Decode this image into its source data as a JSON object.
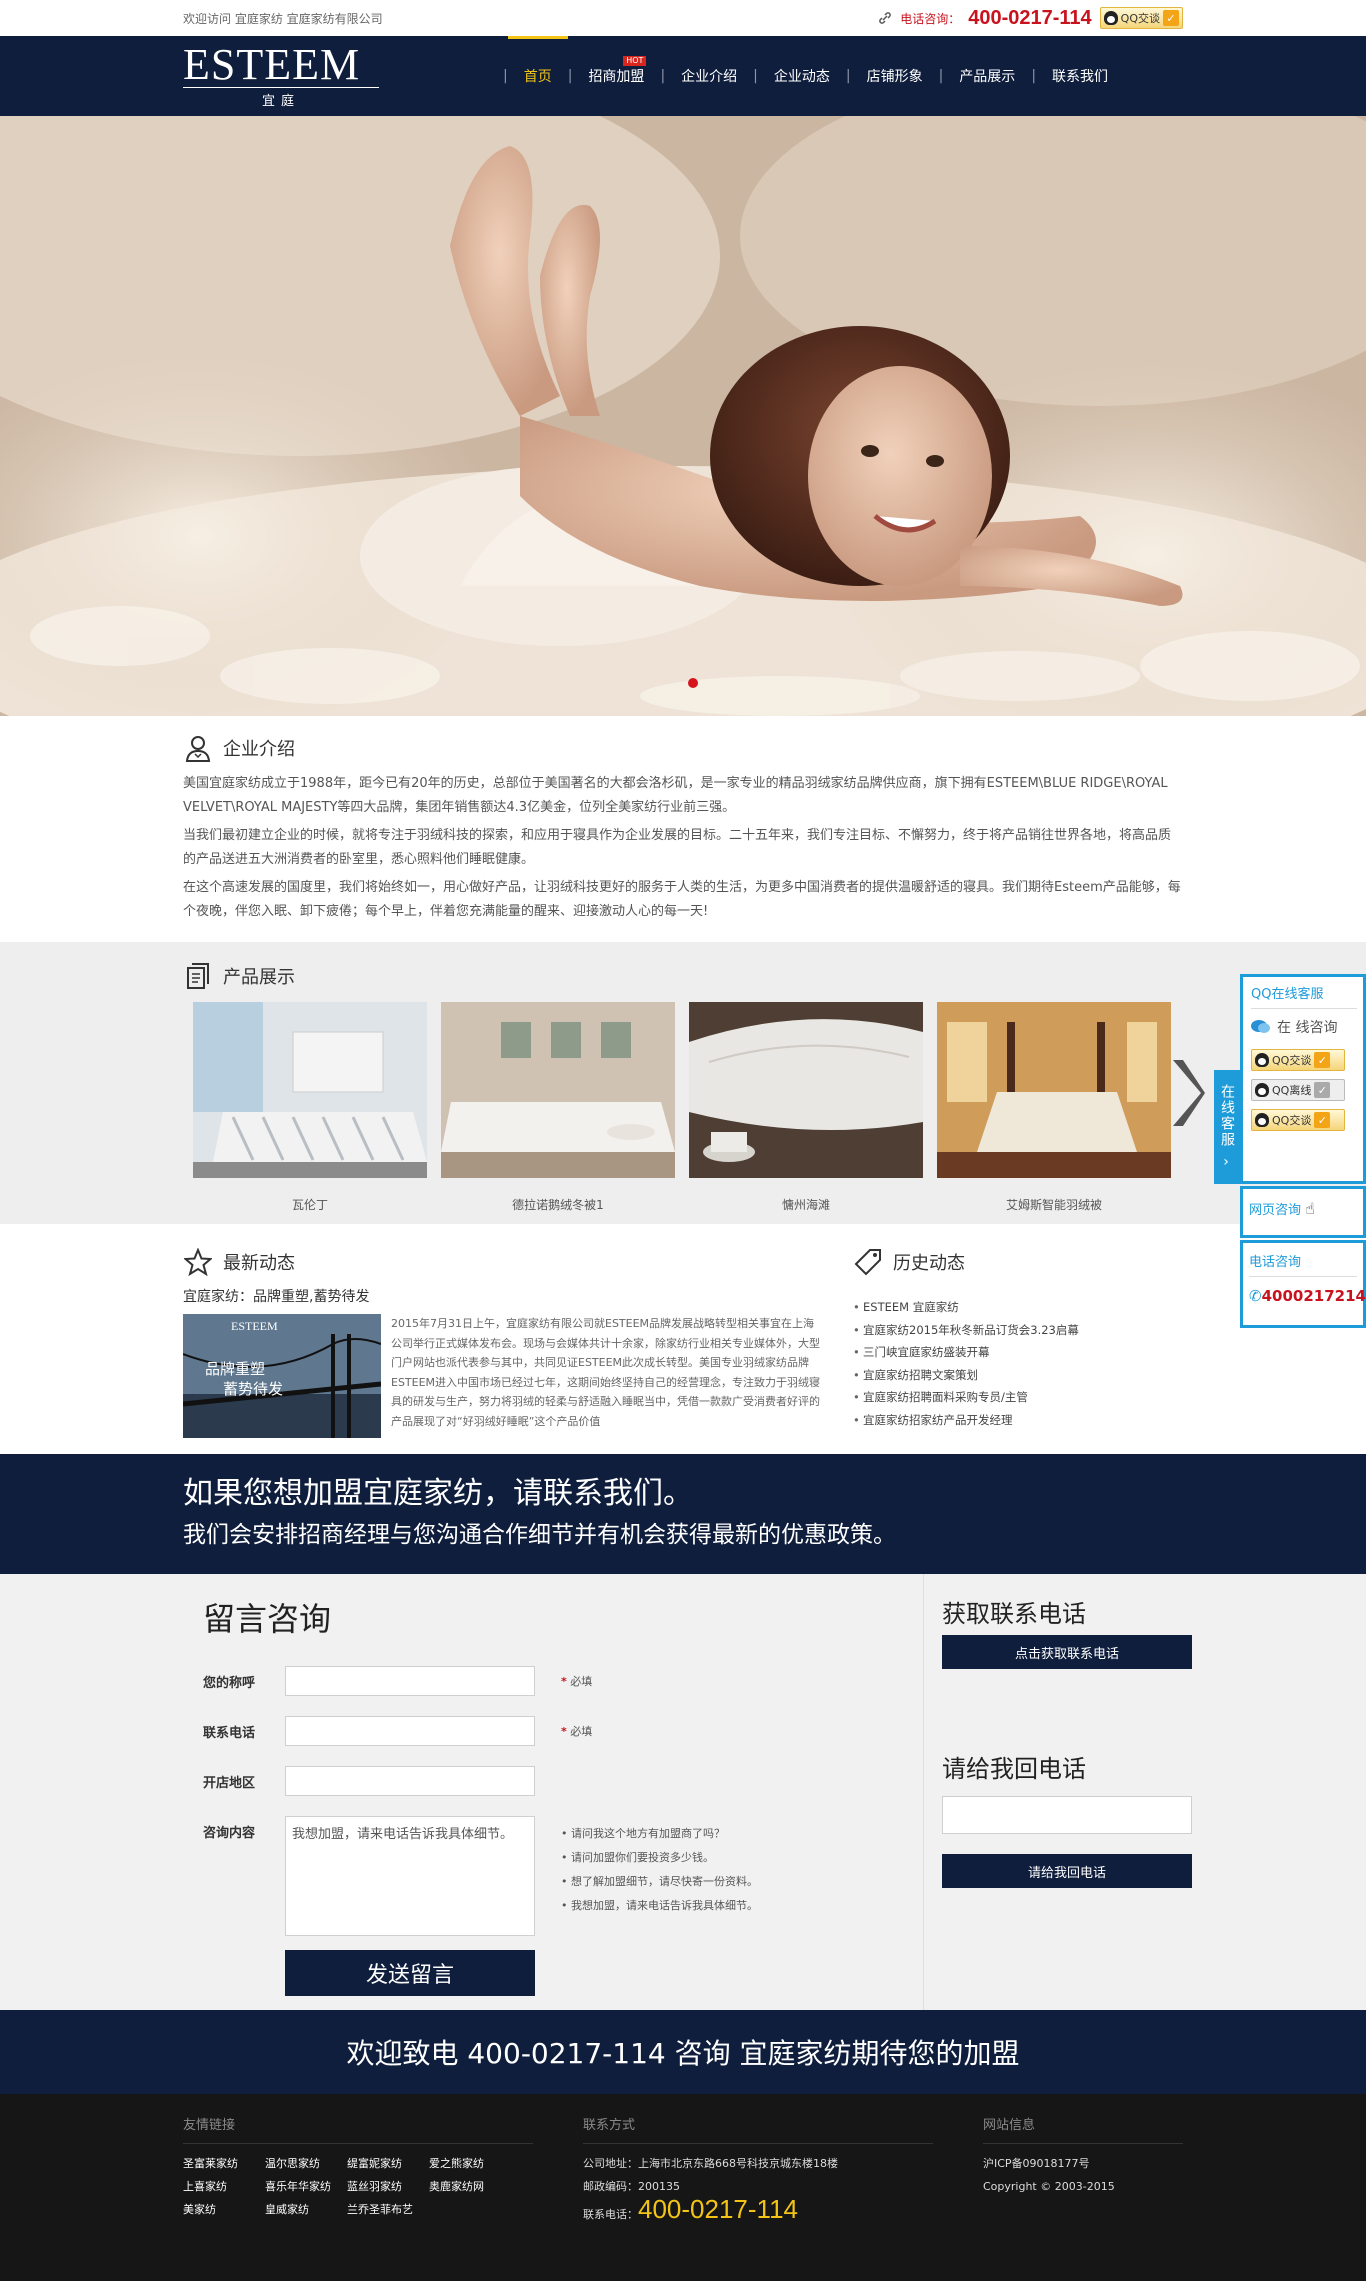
{
  "topbar": {
    "welcome": "欢迎访问 宜庭家纺 宜庭家纺有限公司",
    "phone_label": "电话咨询：",
    "phone": "400-0217-114",
    "qq_label": "QQ交谈"
  },
  "nav": {
    "logo_brand": "ESTEEM",
    "logo_sub": "宜庭",
    "items": [
      {
        "label": "首页"
      },
      {
        "label": "招商加盟",
        "badge": "HOT"
      },
      {
        "label": "企业介绍"
      },
      {
        "label": "企业动态"
      },
      {
        "label": "店铺形象"
      },
      {
        "label": "产品展示"
      },
      {
        "label": "联系我们"
      }
    ]
  },
  "intro": {
    "title": "企业介绍",
    "p1": "美国宜庭家纺成立于1988年，距今已有20年的历史，总部位于美国著名的大都会洛杉矶，是一家专业的精品羽绒家纺品牌供应商，旗下拥有ESTEEM\\BLUE RIDGE\\ROYAL VELVET\\ROYAL MAJESTY等四大品牌，集团年销售额达4.3亿美金，位列全美家纺行业前三强。",
    "p2": "当我们最初建立企业的时候，就将专注于羽绒科技的探索，和应用于寝具作为企业发展的目标。二十五年来，我们专注目标、不懈努力，终于将产品销往世界各地，将高品质的产品送进五大洲消费者的卧室里，悉心照料他们睡眠健康。",
    "p3": "在这个高速发展的国度里，我们将始终如一，用心做好产品，让羽绒科技更好的服务于人类的生活，为更多中国消费者的提供温暖舒适的寝具。我们期待Esteem产品能够，每个夜晚，伴您入眠、卸下疲倦；每个早上，伴着您充满能量的醒来、迎接激动人心的每一天!"
  },
  "products": {
    "title": "产品展示",
    "items": [
      {
        "name": "瓦伦丁"
      },
      {
        "name": "德拉诺鹅绒冬被1"
      },
      {
        "name": "慵州海滩"
      },
      {
        "name": "艾姆斯智能羽绒被"
      }
    ]
  },
  "news": {
    "title": "最新动态",
    "headline": "宜庭家纺：品牌重塑,蓄势待发",
    "thumb_logo": "ESTEEM",
    "thumb_text1": "品牌重塑",
    "thumb_text2": "蓄势待发",
    "body": "2015年7月31日上午，宜庭家纺有限公司就ESTEEM品牌发展战略转型相关事宜在上海公司举行正式媒体发布会。现场与会媒体共计十余家，除家纺行业相关专业媒体外，大型门户网站也派代表参与其中，共同见证ESTEEM此次成长转型。美国专业羽绒家纺品牌ESTEEM进入中国市场已经过七年，这期间始终坚持自己的经营理念，专注致力于羽绒寝具的研发与生产，努力将羽绒的轻柔与舒适融入睡眠当中，凭借一款款广受消费者好评的产品展现了对“好羽绒好睡眠”这个产品价值"
  },
  "history": {
    "title": "历史动态",
    "items": [
      "ESTEEM 宜庭家纺",
      "宜庭家纺2015年秋冬新品订货会3.23启幕",
      "三门峡宜庭家纺盛装开幕",
      "宜庭家纺招聘文案策划",
      "宜庭家纺招聘面料采购专员/主管",
      "宜庭家纺招家纺产品开发经理"
    ]
  },
  "banner": {
    "line1": "如果您想加盟宜庭家纺，请联系我们。",
    "line2": "我们会安排招商经理与您沟通合作细节并有机会获得最新的优惠政策。"
  },
  "form": {
    "title": "留言咨询",
    "name_label": "您的称呼",
    "phone_label": "联系电话",
    "region_label": "开店地区",
    "content_label": "咨询内容",
    "required": "必填",
    "message_value": "我想加盟，请来电话告诉我具体细节。",
    "hints": [
      "请问我这个地方有加盟商了吗？",
      "请问加盟你们要投资多少钱。",
      "想了解加盟细节，请尽快寄一份资料。",
      "我想加盟，请来电话告诉我具体细节。"
    ],
    "submit": "发送留言"
  },
  "side": {
    "get_phone_title": "获取联系电话",
    "get_phone_btn": "点击获取联系电话",
    "callback_title": "请给我回电话",
    "callback_btn": "请给我回电话"
  },
  "callstrip": {
    "text": "欢迎致电 400-0217-114 咨询 宜庭家纺期待您的加盟"
  },
  "footer": {
    "links_title": "友情链接",
    "links": [
      "圣富莱家纺",
      "温尔思家纺",
      "缇富妮家纺",
      "爱之熊家纺",
      "上喜家纺",
      "喜乐年华家纺",
      "蓝丝羽家纺",
      "奥鹿家纺网",
      "美家纺",
      "皇威家纺",
      "兰乔圣菲布艺"
    ],
    "contact_title": "联系方式",
    "address": "公司地址：上海市北京东路668号科技京城东楼18楼",
    "zip": "邮政编码：200135",
    "phone_label": "联系电话：",
    "phone": "400-0217-114",
    "site_title": "网站信息",
    "icp": "沪ICP备09018177号",
    "copyright": "Copyright © 2003-2015"
  },
  "float_widget": {
    "qq_title": "QQ在线客服",
    "online": "在 线咨询",
    "qq1": "QQ交谈",
    "qq2": "QQ离线",
    "qq3": "QQ交谈",
    "tab": "在线客服",
    "web": "网页咨询",
    "phone_title": "电话咨询",
    "phone": "4000217214"
  },
  "colors": {
    "navy": "#0f1e3d",
    "accent": "#f3c416",
    "red": "#c8131f",
    "widget_blue": "#1e9bd9"
  }
}
